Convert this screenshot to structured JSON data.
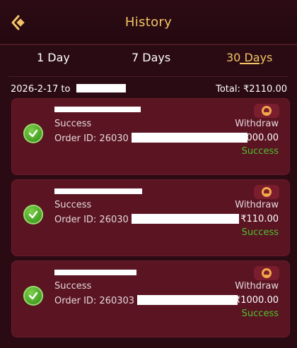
{
  "header": {
    "title": "History"
  },
  "tabs": [
    {
      "label": "1 Day"
    },
    {
      "label": "7 Days"
    },
    {
      "label": "30 Days"
    }
  ],
  "summary": {
    "date_prefix": "2026-2-17 to",
    "total": "Total: ₹2110.00"
  },
  "records": [
    {
      "status": "Success",
      "order_prefix": "Order ID: 26030",
      "type": "Withdraw",
      "amount": "₹1000.00",
      "result": "Success"
    },
    {
      "status": "Success",
      "order_prefix": "Order ID: 26030",
      "type": "Withdraw",
      "amount": "₹110.00",
      "result": "Success"
    },
    {
      "status": "Success",
      "order_prefix": "Order ID: 260303",
      "type": "Withdraw",
      "amount": "₹1000.00",
      "result": "Success"
    }
  ],
  "colors": {
    "accent": "#f3c566",
    "success": "#4fc02f",
    "card": "#5a1422",
    "background": "#2a0b13"
  },
  "icons": {
    "back": "back-arrow-icon",
    "check": "check-circle-icon",
    "support": "support-headset-icon"
  }
}
